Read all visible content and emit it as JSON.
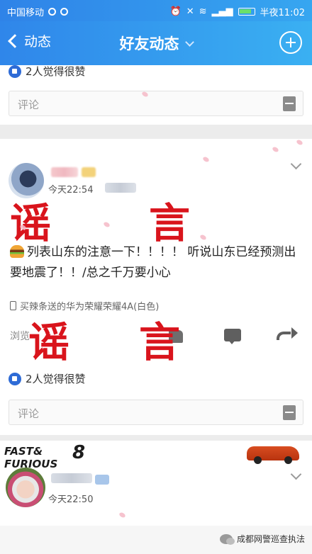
{
  "status_bar": {
    "carrier": "中国移动",
    "time": "半夜11:02",
    "icons": [
      "alarm-icon",
      "mute-icon",
      "wifi-icon",
      "signal-icon",
      "battery-icon"
    ]
  },
  "nav": {
    "back_label": "动态",
    "title": "好友动态"
  },
  "top_card": {
    "likes": "2人觉得很赞",
    "comment_placeholder": "评论"
  },
  "post1": {
    "time": "今天22:54",
    "overlay_text": [
      "谣",
      "言",
      "谣",
      "言"
    ],
    "text": "列表山东的注意一下！！！！ 听说山东已经预测出要地震了！！/总之千万要小心",
    "device": "买辣条送的华为荣耀荣耀4A(白色)",
    "browse_prefix": "浏览",
    "likes": "2人觉得很赞",
    "comment_placeholder": "评论"
  },
  "post2": {
    "logo_line1": "FAST&",
    "logo_line2": "FURIOUS",
    "logo_number": "8",
    "time": "今天22:50"
  },
  "watermark": "成都网警巡查执法"
}
